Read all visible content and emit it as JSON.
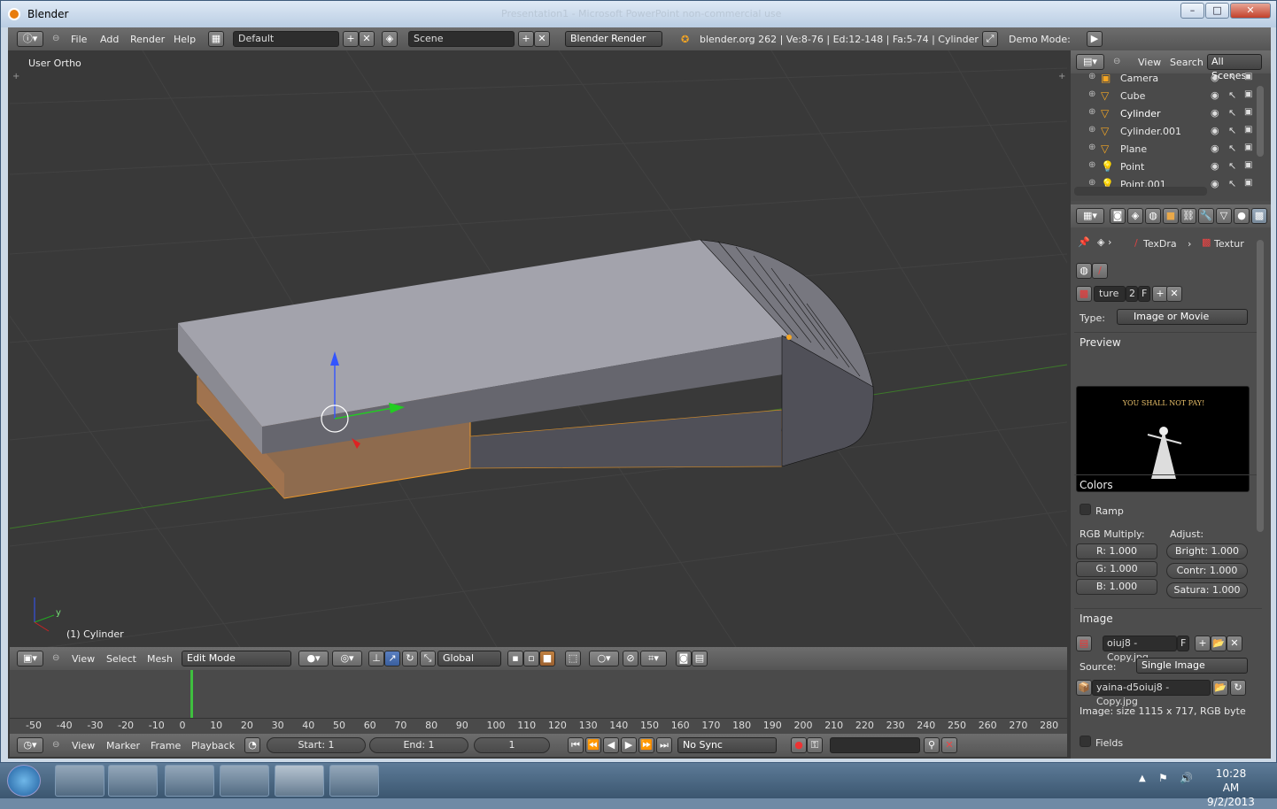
{
  "window": {
    "title": "Blender",
    "ghost_title": "Presentation1 - Microsoft PowerPoint non-commercial use"
  },
  "info_header": {
    "menus": [
      "File",
      "Add",
      "Render",
      "Help"
    ],
    "layout": "Default",
    "scene": "Scene",
    "engine": "Blender Render",
    "stats": "blender.org 262 | Ve:8-76 | Ed:12-148 | Fa:5-74 | Cylinder",
    "demo_mode": "Demo Mode:"
  },
  "viewport": {
    "view_label": "User Ortho",
    "object_label": "(1) Cylinder",
    "axis_y": "y"
  },
  "view3d_header": {
    "menus": [
      "View",
      "Select",
      "Mesh"
    ],
    "mode": "Edit Mode",
    "orientation": "Global"
  },
  "timeline": {
    "ticks": [
      "-50",
      "-40",
      "-30",
      "-20",
      "-10",
      "0",
      "10",
      "20",
      "30",
      "40",
      "50",
      "60",
      "70",
      "80",
      "90",
      "100",
      "110",
      "120",
      "130",
      "140",
      "150",
      "160",
      "170",
      "180",
      "190",
      "200",
      "210",
      "220",
      "230",
      "240",
      "250",
      "260",
      "270",
      "280"
    ],
    "menus": [
      "View",
      "Marker",
      "Frame",
      "Playback"
    ],
    "start": "Start: 1",
    "end": "End: 1",
    "current": "1",
    "sync": "No Sync"
  },
  "outliner": {
    "menus": [
      "View",
      "Search"
    ],
    "filter": "All Scenes",
    "items": [
      {
        "name": "Camera",
        "icon": "camera-icon"
      },
      {
        "name": "Cube",
        "icon": "mesh-icon"
      },
      {
        "name": "Cylinder",
        "icon": "mesh-icon"
      },
      {
        "name": "Cylinder.001",
        "icon": "mesh-icon"
      },
      {
        "name": "Plane",
        "icon": "mesh-icon"
      },
      {
        "name": "Point",
        "icon": "lamp-icon"
      },
      {
        "name": "Point.001",
        "icon": "lamp-icon"
      }
    ]
  },
  "properties": {
    "breadcrumb": [
      "TexDra",
      "Textur"
    ],
    "texture_name": "ture",
    "texture_users": "2",
    "texture_fake": "F",
    "type_label": "Type:",
    "type_value": "Image or Movie",
    "preview_label": "Preview",
    "preview_text": "YOU SHALL NOT PAY!",
    "colors_label": "Colors",
    "ramp_label": "Ramp",
    "rgb_label": "RGB Multiply:",
    "adjust_label": "Adjust:",
    "r": "R: 1.000",
    "g": "G: 1.000",
    "b": "B: 1.000",
    "bright": "Bright: 1.000",
    "contr": "Contr: 1.000",
    "satura": "Satura: 1.000",
    "image_label": "Image",
    "image_name": "oiuj8 - Copy.jpg",
    "image_fake": "F",
    "source_label": "Source:",
    "source_value": "Single Image",
    "filepath": "yaina-d5oiuj8 - Copy.jpg",
    "image_info": "Image: size 1115 x 717, RGB byte",
    "fields_label": "Fields"
  },
  "taskbar": {
    "time": "10:28 AM",
    "date": "9/2/2013"
  },
  "colors": {
    "accent_orange": "#f5a623",
    "viewport_bg": "#393939",
    "header": "#5f5f5f"
  }
}
